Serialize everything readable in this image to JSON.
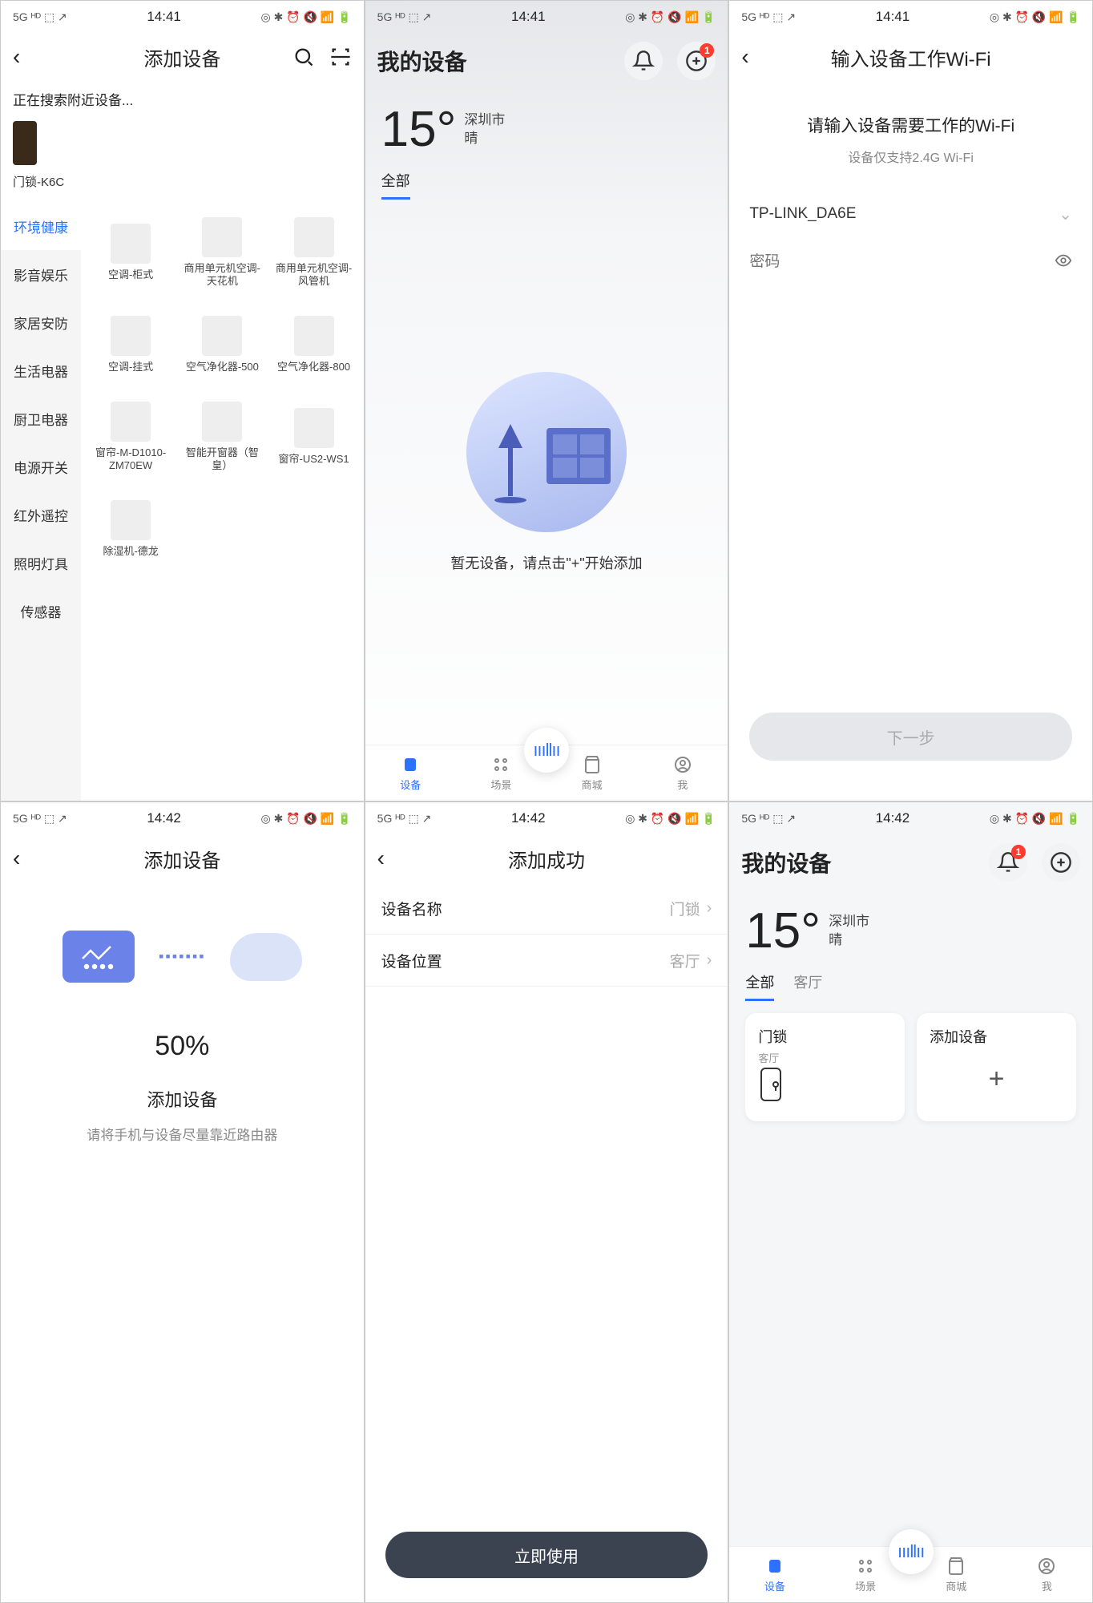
{
  "statusbar": {
    "time1": "14:41",
    "time2": "14:42",
    "signal": "5G",
    "icons_left": "ᴴᴰ ⬚ ↗",
    "icons_right": "◎ ✱ ⏰ 🔇 📶 🔋"
  },
  "panel1": {
    "title": "添加设备",
    "searching": "正在搜索附近设备...",
    "found_label": "门锁-K6C",
    "categories": [
      "环境健康",
      "影音娱乐",
      "家居安防",
      "生活电器",
      "厨卫电器",
      "电源开关",
      "红外遥控",
      "照明灯具",
      "传感器"
    ],
    "devices": [
      "空调-柜式",
      "商用单元机空调-天花机",
      "商用单元机空调-风管机",
      "空调-挂式",
      "空气净化器-500",
      "空气净化器-800",
      "窗帘-M-D1010-ZM70EW",
      "智能开窗器（智皇）",
      "窗帘-US2-WS1",
      "除湿机-德龙"
    ]
  },
  "panel2": {
    "title": "我的设备",
    "temp": "15°",
    "city": "深圳市",
    "weather": "晴",
    "tab_all": "全部",
    "empty": "暂无设备，请点击\"+\"开始添加",
    "badge": "1",
    "nav": {
      "devices": "设备",
      "scenes": "场景",
      "mall": "商城",
      "me": "我"
    }
  },
  "panel3": {
    "title": "输入设备工作Wi-Fi",
    "prompt": "请输入设备需要工作的Wi-Fi",
    "hint": "设备仅支持2.4G Wi-Fi",
    "ssid": "TP-LINK_DA6E",
    "pwd_placeholder": "密码",
    "next": "下一步"
  },
  "panel4": {
    "title": "添加设备",
    "pct": "50%",
    "status": "添加设备",
    "tip": "请将手机与设备尽量靠近路由器"
  },
  "panel5": {
    "title": "添加成功",
    "name_label": "设备名称",
    "name_val": "门锁",
    "loc_label": "设备位置",
    "loc_val": "客厅",
    "use": "立即使用"
  },
  "panel6": {
    "title": "我的设备",
    "temp": "15°",
    "city": "深圳市",
    "weather": "晴",
    "tab_all": "全部",
    "tab_room": "客厅",
    "badge": "1",
    "card_lock": "门锁",
    "card_lock_sub": "客厅",
    "card_add": "添加设备",
    "nav": {
      "devices": "设备",
      "scenes": "场景",
      "mall": "商城",
      "me": "我"
    }
  }
}
